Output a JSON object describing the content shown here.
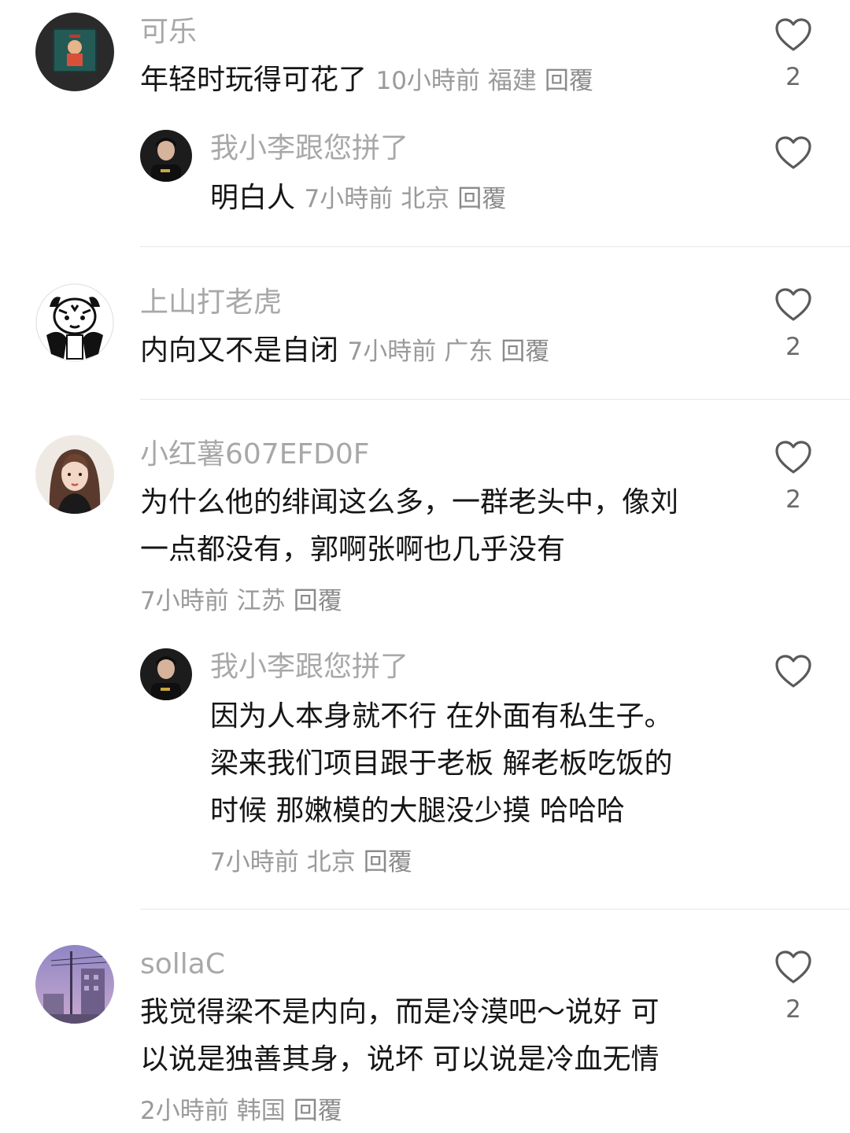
{
  "comments": [
    {
      "username": "可乐",
      "text_lines": [
        "年轻时玩得可花了"
      ],
      "time": "10小時前",
      "location": "福建",
      "reply_label": "回覆",
      "like_count": "2",
      "replies": [
        {
          "username": "我小李跟您拼了",
          "text_lines": [
            "明白人"
          ],
          "time": "7小時前",
          "location": "北京",
          "reply_label": "回覆"
        }
      ]
    },
    {
      "username": "上山打老虎",
      "text_lines": [
        "内向又不是自闭"
      ],
      "time": "7小時前",
      "location": "广东",
      "reply_label": "回覆",
      "like_count": "2"
    },
    {
      "username": "小红薯607EFD0F",
      "text_lines": [
        "为什么他的绯闻这么多，一群老头中，像刘",
        "一点都没有，郭啊张啊也几乎没有"
      ],
      "time": "7小時前",
      "location": "江苏",
      "reply_label": "回覆",
      "like_count": "2",
      "replies": [
        {
          "username": "我小李跟您拼了",
          "text_lines": [
            "因为人本身就不行 在外面有私生子。",
            "梁来我们项目跟于老板 解老板吃饭的",
            "时候 那嫩模的大腿没少摸 哈哈哈"
          ],
          "time": "7小時前",
          "location": "北京",
          "reply_label": "回覆"
        }
      ]
    },
    {
      "username": "sollaC",
      "text_lines": [
        "我觉得梁不是内向，而是冷漠吧～说好 可",
        "以说是独善其身，说坏 可以说是冷血无情"
      ],
      "time": "2小時前",
      "location": "韩国",
      "reply_label": "回覆",
      "like_count": "2"
    }
  ],
  "icons": {
    "like": "heart-outline-icon"
  },
  "colors": {
    "username": "#a8a8a8",
    "text": "#161616",
    "meta": "#9a9a9a",
    "divider": "#e6e6e6"
  }
}
